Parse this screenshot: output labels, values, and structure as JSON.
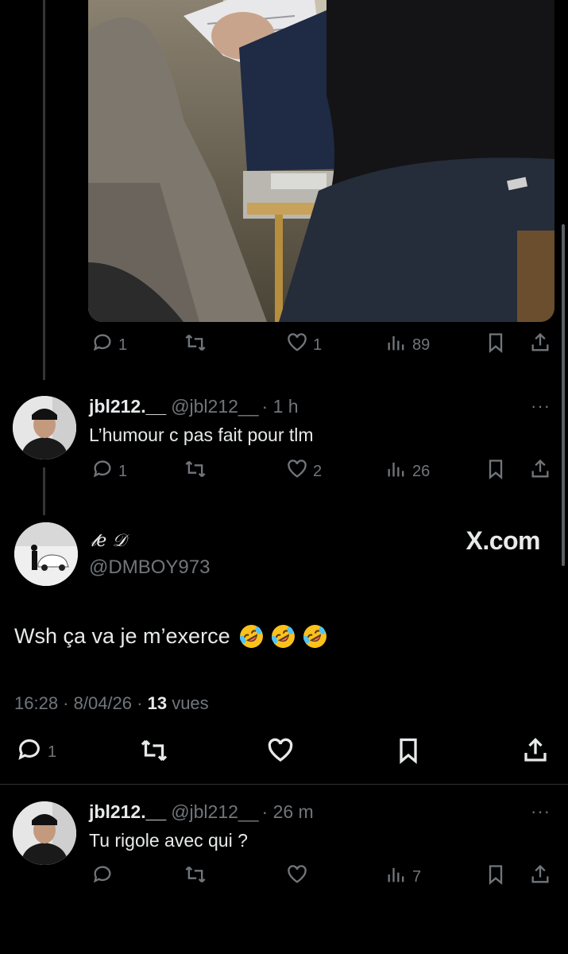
{
  "thread_top": {
    "replies": "1",
    "likes": "1",
    "views": "89"
  },
  "reply1": {
    "name": "jbl212.__",
    "handle": "@jbl212__",
    "time": "· 1 h",
    "text": "L’humour c pas fait pour tlm",
    "replies": "1",
    "likes": "2",
    "views": "26",
    "menu": "···"
  },
  "main_tweet": {
    "display_name": "𝓁𝑒 𝒟",
    "handle": "@DMBOY973",
    "brand": "X.com",
    "text": "Wsh ça va je m’exerce",
    "emoji": [
      "rolling-on-floor-laughing",
      "rolling-on-floor-laughing",
      "rolling-on-floor-laughing"
    ],
    "timestamp": "16:28 · 8/04/26 ·",
    "views_count": "13",
    "views_label": "vues",
    "replies": "1"
  },
  "reply2": {
    "name": "jbl212.__",
    "handle": "@jbl212__",
    "time": "· 26 m",
    "text": "Tu rigole avec qui ?",
    "views": "7",
    "menu": "···"
  },
  "icons": {
    "reply": "reply-icon",
    "retweet": "retweet-icon",
    "like": "heart-icon",
    "views": "views-icon",
    "bookmark": "bookmark-icon",
    "share": "share-icon"
  },
  "colors": {
    "background": "#000000",
    "text": "#e7e9ea",
    "muted": "#71767b",
    "divider": "#2f3336"
  }
}
